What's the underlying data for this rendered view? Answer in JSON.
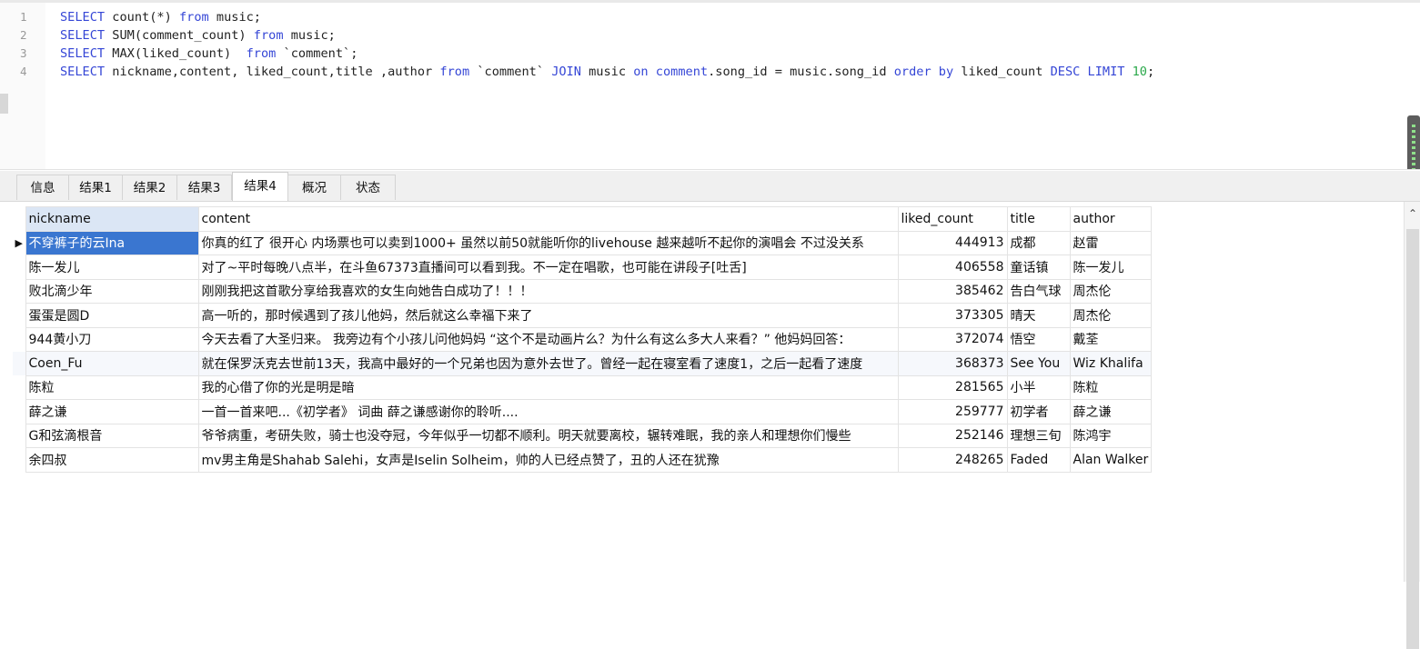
{
  "editor": {
    "lines": [
      {
        "num": "1",
        "tokens": [
          {
            "t": "kw",
            "v": "SELECT"
          },
          {
            "t": "fn",
            "v": " count(*) "
          },
          {
            "t": "kw",
            "v": "from"
          },
          {
            "t": "fn",
            "v": " music;"
          }
        ]
      },
      {
        "num": "2",
        "tokens": [
          {
            "t": "kw",
            "v": "SELECT"
          },
          {
            "t": "fn",
            "v": " SUM(comment_count) "
          },
          {
            "t": "kw",
            "v": "from"
          },
          {
            "t": "fn",
            "v": " music;"
          }
        ]
      },
      {
        "num": "3",
        "tokens": [
          {
            "t": "kw",
            "v": "SELECT"
          },
          {
            "t": "fn",
            "v": " MAX(liked_count)  "
          },
          {
            "t": "kw",
            "v": "from"
          },
          {
            "t": "str",
            "v": " `comment`;"
          }
        ]
      },
      {
        "num": "4",
        "tokens": [
          {
            "t": "kw",
            "v": "SELECT"
          },
          {
            "t": "fn",
            "v": " nickname,content, liked_count,title ,author "
          },
          {
            "t": "kw",
            "v": "from"
          },
          {
            "t": "str",
            "v": " `comment` "
          },
          {
            "t": "kw",
            "v": "JOIN"
          },
          {
            "t": "fn",
            "v": " music "
          },
          {
            "t": "kw",
            "v": "on"
          },
          {
            "t": "kw",
            "v": " comment"
          },
          {
            "t": "fn",
            "v": ".song_id = music.song_id "
          },
          {
            "t": "kw",
            "v": "order by"
          },
          {
            "t": "fn",
            "v": " liked_count "
          },
          {
            "t": "kw",
            "v": "DESC LIMIT"
          },
          {
            "t": "num",
            "v": " 10"
          },
          {
            "t": "fn",
            "v": ";"
          }
        ]
      }
    ]
  },
  "tabs": [
    {
      "label": "信息"
    },
    {
      "label": "结果1"
    },
    {
      "label": "结果2"
    },
    {
      "label": "结果3"
    },
    {
      "label": "结果4",
      "active": true
    },
    {
      "label": "概况"
    },
    {
      "label": "状态"
    }
  ],
  "grid": {
    "columns": [
      "nickname",
      "content",
      "liked_count",
      "title",
      "author"
    ],
    "row_marker": "▶",
    "rows": [
      [
        "不穿裤子的云Ina",
        "你真的红了 很开心 内场票也可以卖到1000+ 虽然以前50就能听你的livehouse 越来越听不起你的演唱会 不过没关系",
        "444913",
        "成都",
        "赵雷"
      ],
      [
        "陈一发儿",
        "对了~平时每晚八点半，在斗鱼67373直播间可以看到我。不一定在唱歌，也可能在讲段子[吐舌]",
        "406558",
        "童话镇",
        "陈一发儿"
      ],
      [
        "败北滴少年",
        "刚刚我把这首歌分享给我喜欢的女生向她告白成功了！！！",
        "385462",
        "告白气球",
        "周杰伦"
      ],
      [
        "蛋蛋是圆D",
        "高一听的，那时候遇到了孩儿他妈，然后就这么幸福下来了",
        "373305",
        "晴天",
        "周杰伦"
      ],
      [
        "944黄小刀",
        "今天去看了大圣归来。 我旁边有个小孩儿问他妈妈 “这个不是动画片么？为什么有这么多大人来看？” 他妈妈回答：",
        "372074",
        "悟空",
        "戴荃"
      ],
      [
        "Coen_Fu",
        "就在保罗沃克去世前13天，我高中最好的一个兄弟也因为意外去世了。曾经一起在寝室看了速度1，之后一起看了速度",
        "368373",
        "See You",
        "Wiz Khalifa"
      ],
      [
        "陈粒",
        "我的心借了你的光是明是暗",
        "281565",
        "小半",
        "陈粒"
      ],
      [
        "薛之谦",
        "一首一首来吧...《初学者》 词曲 薛之谦感谢你的聆听....",
        "259777",
        "初学者",
        "薛之谦"
      ],
      [
        "G和弦滴根音",
        "爷爷病重，考研失败，骑士也没夺冠，今年似乎一切都不顺利。明天就要离校，辗转难眠，我的亲人和理想你们慢些",
        "252146",
        "理想三旬",
        "陈鸿宇"
      ],
      [
        "余四叔",
        "mv男主角是Shahab Salehi，女声是Iselin Solheim，帅的人已经点赞了，丑的人还在犹豫",
        "248265",
        "Faded",
        "Alan Walker"
      ]
    ]
  },
  "icons": {
    "scroll_up": "chevron-up-icon"
  },
  "colors": {
    "keyword": "#3546d6",
    "number": "#2aa84a",
    "selected_cell": "#3a76d0",
    "selected_header": "#dbe6f5"
  }
}
